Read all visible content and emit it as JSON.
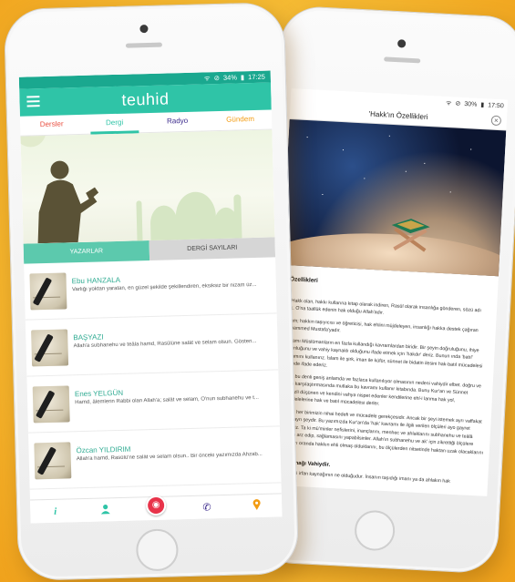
{
  "front": {
    "status": {
      "time": "17:25",
      "battery": "34%"
    },
    "app_title": "teuhid",
    "tabs": [
      {
        "label": "Dersler",
        "color": "#e94c3d"
      },
      {
        "label": "Dergi",
        "color": "#2fc4a7"
      },
      {
        "label": "Radyo",
        "color": "#3b2a8c"
      },
      {
        "label": "Gündem",
        "color": "#f39c12"
      }
    ],
    "segments": [
      "YAZARLAR",
      "DERGİ SAYILARI"
    ],
    "articles": [
      {
        "author": "Ebu HANZALA",
        "snippet": "Varlığı yoktan yaratan, en güzel şekilde şekillendiren, eksiksiz bir nizam üz..."
      },
      {
        "author": "BAŞYAZI",
        "snippet": "Allah'a subhanehu ve teâla hamd, Rasûlüne salât ve selam olsun. Gösteri..."
      },
      {
        "author": "Enes YELGÜN",
        "snippet": "Hamd, âlemlerin Rabbi olan Allah'a; salât ve selam, O'nun subhanehu ve t..."
      },
      {
        "author": "Özcan YILDIRIM",
        "snippet": "Allah'a hamd, Rasûlü'ne salât ve selam olsun.. Bir önceki yazımızda Ahzab..."
      }
    ],
    "bottom_nav": [
      {
        "icon": "info-icon",
        "glyph": "i",
        "color": "#2fc4a7"
      },
      {
        "icon": "user-icon",
        "glyph": "👤",
        "color": "#2fc4a7"
      },
      {
        "icon": "radio-icon",
        "glyph": "◉",
        "color": "#e8334a"
      },
      {
        "icon": "phone-icon",
        "glyph": "✆",
        "color": "#3b2a8c"
      },
      {
        "icon": "location-icon",
        "glyph": "⚲",
        "color": "#f39c12"
      }
    ]
  },
  "back": {
    "status": {
      "time": "17:50",
      "battery": "30%"
    },
    "title": "'Hakk'ın Özellikleri",
    "heading": "ı Özellikleri",
    "paragraphs": [
      "El-Hakk olan, hakkı kullarına kitap olarak indiren, Rasûl olarak insanlığa gönderen, sözü adı hak. O'na taallük edenin hak olduğu Allah'adır.",
      "selam; hakkın taşıyıcısı ve öğreticisi, hak ehlini müjdeleyen, insanlığı hakka destek çağıran Muhammed Mustafa'yadır.",
      "kavramı Müslümanların en fazla kullandığı kavramlardan biridir. Bir şeyin doğruluğunu, ihiye uygunluğunu ve vahiy kaynaklı olduğunu ifade etmek için 'hakdır' deriz. Bunun ında 'batıl' kavramını kullanırız. İslam ile şirk, iman ile küfür, sünnet ile bidatin ilesini hak-batıl mücadelesi şeklinde ifade ederiz.",
      "tamın bu denli geniş anlamda ve fazlaca kullanılıyor olmasının nedeni vahiydir elbet. doğru ve yanlış karşılaştırmasında mutlaka bu kavramı kullanır kitabında. Bunu Kur'an ve Sünnet merkezli düşünen ve kendini vahyə nispet edenler kendilerine ehl-i lanma hak yol, mücadelelerine hak ve batıl mücadelesi derler.",
      "i olmak her birimizin nihai hedefi ve mücadele gerekçesidir. Ancak bir şeyi istemek ayrı vaffakat etmek ayrı şeydir. Bu yazımızda Kur'an'da 'hak' kavramı ile ilgili verilen ölçüleri ayo gayret edeceğiz. Ta ki mü'minler nefislerini, inançlarını, menhec ve ahlaklarını subhanehu ve teâlâ kitabına arz edip, sağlamasını yapabilsinler. Allah'ın subhanehu ve ak' için zikrettiği ölçülere aydukları oranda hakkın ehli olmaş olduklarını, bu ölçülerden nitsetinde haktan uzak olacaklarını bilsinler."
    ],
    "subheading": "an Kaynağı Vahiydir.",
    "tail": "an önemli irfan kaynağının ne olduğudur. İnsanın taşıdığı imanı ya da ahlakın hak"
  }
}
